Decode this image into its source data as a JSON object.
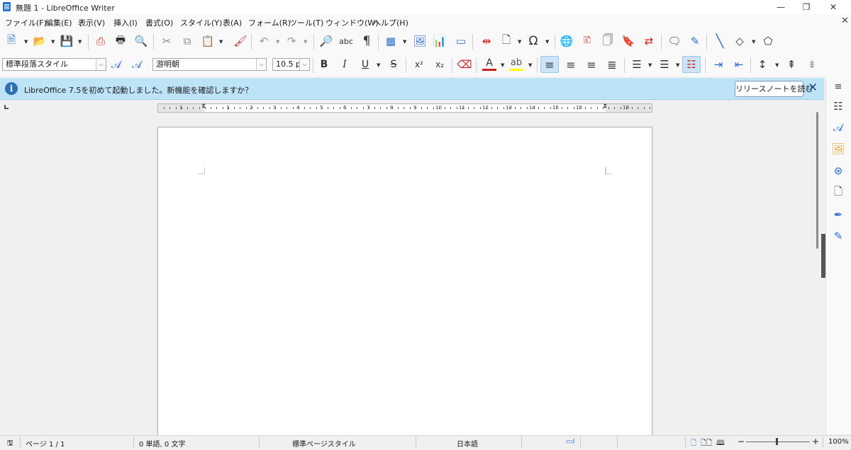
{
  "window": {
    "title": "無題 1 - LibreOffice Writer",
    "minimize": "—",
    "restore": "❐",
    "close": "✕"
  },
  "menu": [
    "ファイル(F)",
    "編集(E)",
    "表示(V)",
    "挿入(I)",
    "書式(O)",
    "スタイル(Y)",
    "表(A)",
    "フォーム(R)",
    "ツール(T)",
    "ウィンドウ(W)",
    "ヘルプ(H)"
  ],
  "document_close": "✕",
  "formatting": {
    "paragraph_style": "標準段落スタイル",
    "font_name": "游明朝",
    "font_size": "10.5 pt",
    "bold": "B",
    "italic": "I",
    "underline": "U",
    "strikethrough": "S",
    "superscript": "x²",
    "subscript": "x₂"
  },
  "infobar": {
    "message": "LibreOffice 7.5を初めて起動しました。新機能を確認しますか？",
    "button": "リリースノートを読む",
    "close": "✕"
  },
  "ruler": {
    "numbers": [
      "1",
      "1",
      "2",
      "3",
      "4",
      "5",
      "6",
      "7",
      "8",
      "9",
      "10",
      "11",
      "12",
      "13",
      "14",
      "15",
      "16",
      "18"
    ]
  },
  "statusbar": {
    "page": "ページ 1 / 1",
    "words": "0 単語, 0 文字",
    "page_style": "標準ページスタイル",
    "language": "日本語",
    "zoom": "100%",
    "zoom_minus": "−",
    "zoom_plus": "+"
  },
  "colors": {
    "accent": "#2a6fc9",
    "infobar": "#bde3f7",
    "font_color": "#c9211e",
    "highlight": "#ffff00"
  }
}
